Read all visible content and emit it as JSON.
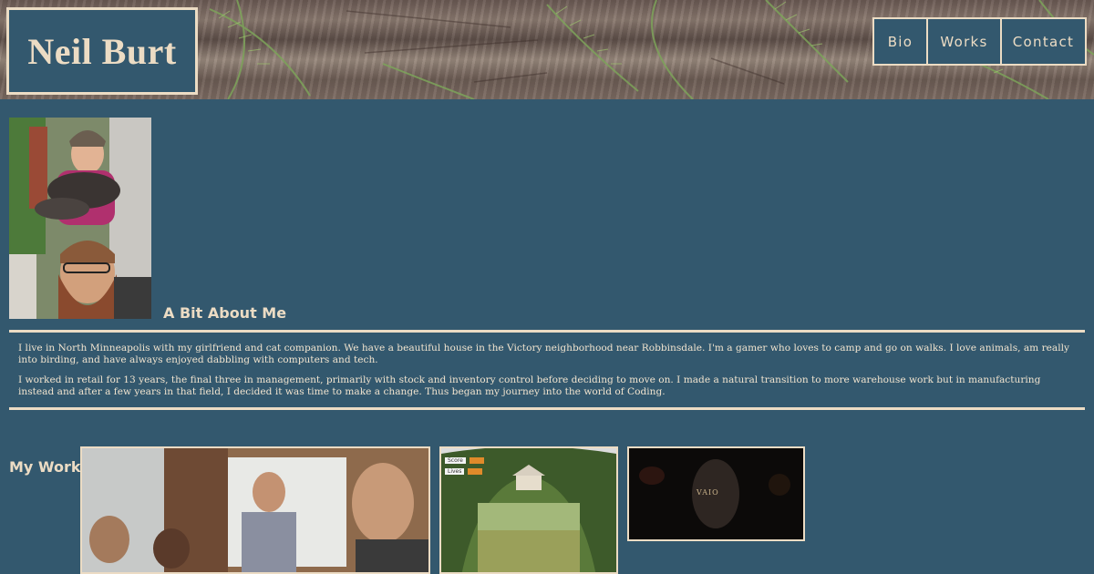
{
  "header": {
    "logo_text": "Neil Burt",
    "nav": [
      {
        "label": "Bio"
      },
      {
        "label": "Works"
      },
      {
        "label": "Contact"
      }
    ]
  },
  "about": {
    "heading": "A Bit About Me",
    "paragraphs": [
      "I live in North Minneapolis with my girlfriend and cat companion. We have a beautiful house in the Victory neighborhood near Robbinsdale. I'm a gamer who loves to camp and go on walks. I love animals, am really into birding, and have always enjoyed dabbling with computers and tech.",
      "I worked in retail for 13 years, the final three in management, primarily with stock and inventory control before deciding to move on. I made a natural transition to more warehouse work but in manufacturing instead and after a few years in that field, I decided it was time to make a change. Thus began my journey into the world of Coding."
    ]
  },
  "work": {
    "heading": "My Work",
    "thumbnails": [
      {
        "alt": "team-meeting-photo"
      },
      {
        "alt": "garden-game-screenshot",
        "hud": {
          "score_label": "Score",
          "lives_label": "Lives"
        }
      },
      {
        "alt": "dark-product-screenshot",
        "brand": "VAIO"
      }
    ]
  },
  "colors": {
    "background": "#33586e",
    "accent": "#ecdcc4",
    "text": "#f1e4cf"
  }
}
